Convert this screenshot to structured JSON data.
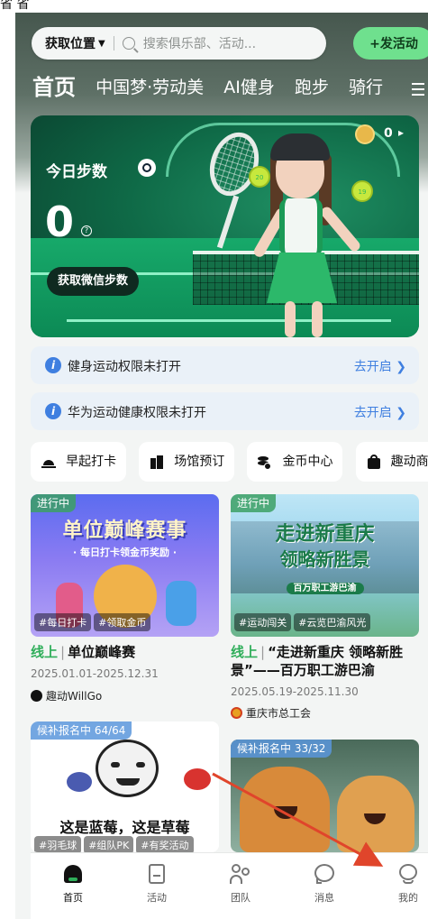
{
  "status_bar": {
    "glyphs": "省  省"
  },
  "top_bar": {
    "location_label": "获取位置",
    "search_placeholder": "搜索俱乐部、活动...",
    "post_button": "+发活动"
  },
  "tabs": [
    {
      "label": "首页",
      "active": true
    },
    {
      "label": "中国梦·劳动美",
      "active": false
    },
    {
      "label": "AI健身",
      "active": false
    },
    {
      "label": "跑步",
      "active": false
    },
    {
      "label": "骑行",
      "active": false
    }
  ],
  "banner": {
    "steps_title": "今日步数",
    "steps_value": "0",
    "wechat_button": "获取微信步数",
    "coin_count": "0",
    "ball_numbers": [
      "20",
      "19"
    ]
  },
  "permissions": [
    {
      "text": "健身运动权限未打开",
      "action": "去开启"
    },
    {
      "text": "华为运动健康权限未打开",
      "action": "去开启"
    }
  ],
  "quick_actions": [
    {
      "label": "早起打卡",
      "icon": "sunrise-icon"
    },
    {
      "label": "场馆预订",
      "icon": "stadium-icon"
    },
    {
      "label": "金币中心",
      "icon": "coins-icon"
    },
    {
      "label": "趣动商",
      "icon": "shop-bag-icon"
    }
  ],
  "cards": [
    {
      "status": "进行中",
      "image_title": "单位巅峰赛事",
      "image_subtitle": "· 每日打卡领金币奖励 ·",
      "tags": [
        "#每日打卡",
        "#领取金币"
      ],
      "prefix": "线上",
      "title": "单位巅峰赛",
      "date": "2025.01.01-2025.12.31",
      "organizer": "趣动WillGo"
    },
    {
      "status": "进行中",
      "image_title": "走进新重庆",
      "image_title2": "领略新胜景",
      "image_subtitle": "百万职工游巴渝",
      "tags": [
        "#运动闯关",
        "#云览巴渝风光"
      ],
      "prefix": "线上",
      "title": "“走进新重庆 领略新胜景”——百万职工游巴渝",
      "date": "2025.05.19-2025.11.30",
      "organizer": "重庆市总工会"
    },
    {
      "status": "候补报名中 64/64",
      "image_caption": "这是蓝莓，这是草莓",
      "tags": [
        "#羽毛球",
        "#组队PK",
        "#有奖活动"
      ]
    },
    {
      "status": "候补报名中 33/32"
    }
  ],
  "bottom_nav": [
    {
      "label": "首页",
      "icon": "home-icon",
      "active": true
    },
    {
      "label": "活动",
      "icon": "activity-icon",
      "active": false
    },
    {
      "label": "团队",
      "icon": "team-icon",
      "active": false
    },
    {
      "label": "消息",
      "icon": "message-icon",
      "active": false
    },
    {
      "label": "我的",
      "icon": "profile-icon",
      "active": false
    }
  ],
  "colors": {
    "accent_green": "#6fe08e",
    "link_blue": "#3f7fe0",
    "online_green": "#2fae5a",
    "annotation_red": "#e0452b"
  }
}
